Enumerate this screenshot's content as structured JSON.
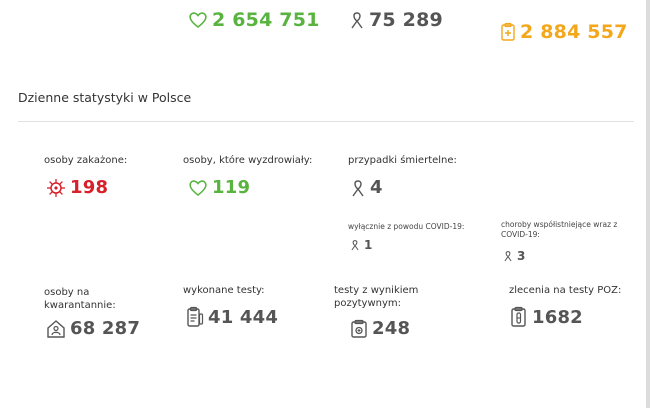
{
  "colors": {
    "infected": "#d7202a",
    "recovered": "#58b33f",
    "tests": "#f2a71c",
    "neutral": "#444444"
  },
  "totals": {
    "recovered": "2 654 751",
    "deaths": "75 289",
    "tests": "2 884 557"
  },
  "daily": {
    "title": "Dzienne statystyki w Polsce",
    "infected": {
      "label": "osoby zakażone:",
      "value": "198",
      "icon": "virus-icon"
    },
    "recovered": {
      "label": "osoby, które wyzdrowiały:",
      "value": "119",
      "icon": "heart-icon"
    },
    "deaths": {
      "label": "przypadki śmiertelne:",
      "value": "4",
      "icon": "ribbon-icon"
    },
    "deaths_covid_only": {
      "label": "wyłącznie z powodu COVID-19:",
      "value": "1",
      "icon": "ribbon-icon"
    },
    "deaths_comorbid": {
      "label": "choroby współistniejące wraz z COVID-19:",
      "value": "3",
      "icon": "ribbon-icon"
    },
    "quarantine": {
      "label": "osoby na kwarantannie:",
      "value": "68 287",
      "icon": "house-person-icon"
    },
    "tests_done": {
      "label": "wykonane testy:",
      "value": "41 444",
      "icon": "clipboard-test-icon"
    },
    "positive_tests": {
      "label": "testy z wynikiem pozytywnym:",
      "value": "248",
      "icon": "positive-test-icon"
    },
    "poz_orders": {
      "label": "zlecenia na testy POZ:",
      "value": "1682",
      "icon": "test-tube-icon"
    }
  }
}
